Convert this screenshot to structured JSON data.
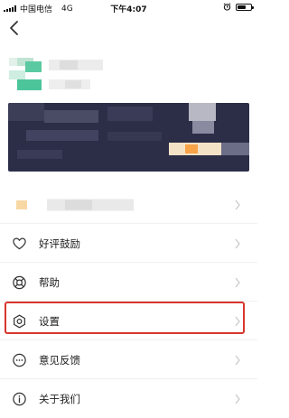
{
  "status_bar": {
    "carrier": "中国电信",
    "network": "4G",
    "time": "下午4:07"
  },
  "menu": {
    "items": [
      {
        "label": "好评鼓励",
        "icon": "heart-icon"
      },
      {
        "label": "帮助",
        "icon": "lifebuoy-icon"
      },
      {
        "label": "设置",
        "icon": "settings-icon"
      },
      {
        "label": "意见反馈",
        "icon": "feedback-icon"
      },
      {
        "label": "关于我们",
        "icon": "info-icon"
      }
    ]
  },
  "colors": {
    "highlight": "#d9352c",
    "avatar_green": "#4cc59a",
    "banner": "#2c2e47"
  }
}
